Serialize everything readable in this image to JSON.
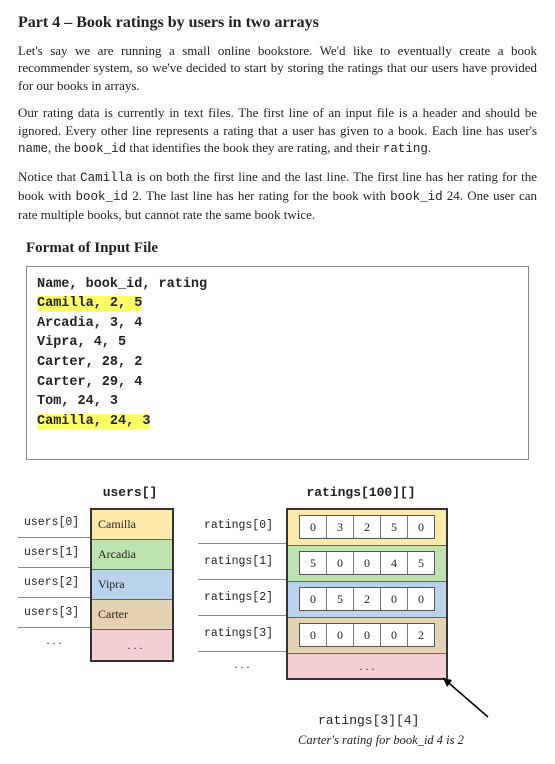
{
  "heading": "Part 4 – Book ratings by users in two arrays",
  "para1_a": "Let's say we are running a small online bookstore. We'd like to eventually create a book recommender system, so we've decided to start by storing the ratings that our users have provided for our books in arrays.",
  "para2_a": "Our rating data is currently in text files. The first line of an input file is a header and should be ignored. Every other line represents a rating that a user has given to a book. Each line has user's ",
  "para2_code1": "name",
  "para2_b": ", the ",
  "para2_code2": "book_id",
  "para2_c": " that identifies the book they are rating, and their ",
  "para2_code3": "rating",
  "para2_d": ".",
  "para3_a": "Notice that ",
  "para3_code1": "Camilla",
  "para3_b": " is on both the first line and the last line. The first line has her rating for the book with ",
  "para3_code2": "book_id",
  "para3_c": " 2. The last line has her rating for the book with ",
  "para3_code3": "book_id",
  "para3_d": " 24. One user can rate multiple books, but cannot rate the same book twice.",
  "format_heading": "Format of Input File",
  "file_lines": {
    "l0": "Name, book_id, rating",
    "l1": "Camilla, 2, 5",
    "l2": "Arcadia, 3, 4",
    "l3": "Vipra, 4, 5",
    "l4": "Carter, 28, 2",
    "l5": "Carter, 29, 4",
    "l6": "Tom, 24, 3",
    "l7": "Camilla, 24, 3"
  },
  "users_title": "users[]",
  "ratings_title": "ratings[100][]",
  "users_labels": {
    "r0": "users[0]",
    "r1": "users[1]",
    "r2": "users[2]",
    "r3": "users[3]"
  },
  "users_vals": {
    "r0": "Camilla",
    "r1": "Arcadia",
    "r2": "Vipra",
    "r3": "Carter"
  },
  "ratings_labels": {
    "r0": "ratings[0]",
    "r1": "ratings[1]",
    "r2": "ratings[2]",
    "r3": "ratings[3]"
  },
  "ratings_vals": {
    "r0": {
      "c0": "0",
      "c1": "3",
      "c2": "2",
      "c3": "5",
      "c4": "0"
    },
    "r1": {
      "c0": "5",
      "c1": "0",
      "c2": "0",
      "c3": "4",
      "c4": "5"
    },
    "r2": {
      "c0": "0",
      "c1": "5",
      "c2": "2",
      "c3": "0",
      "c4": "0"
    },
    "r3": {
      "c0": "0",
      "c1": "0",
      "c2": "0",
      "c3": "0",
      "c4": "2"
    }
  },
  "dots": ". . .",
  "callout_code": "ratings[3][4]",
  "callout_text": "Carter's rating for book_id 4 is 2"
}
